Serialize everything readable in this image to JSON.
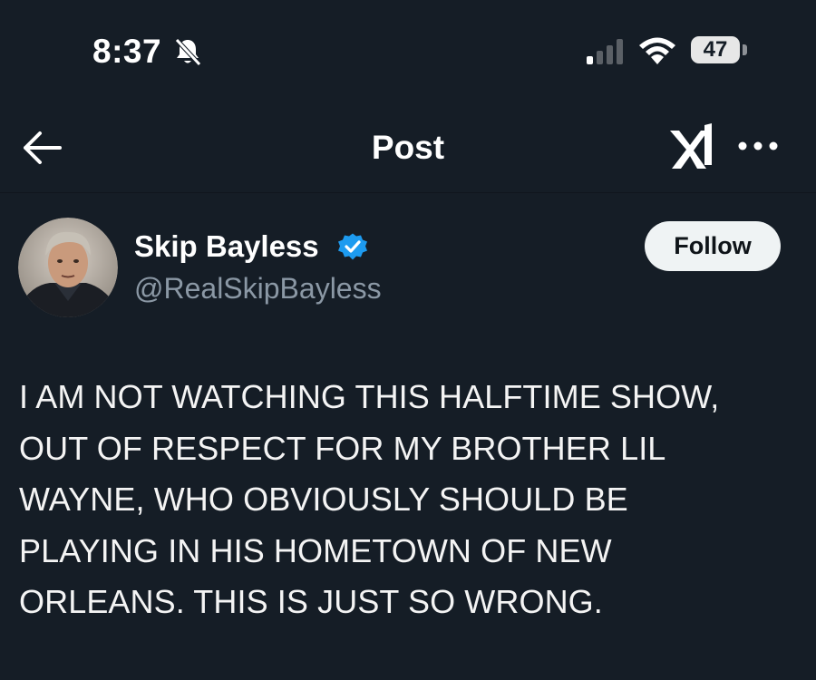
{
  "status_bar": {
    "time": "8:37",
    "battery": "47"
  },
  "header": {
    "title": "Post"
  },
  "post": {
    "author": {
      "name": "Skip Bayless",
      "handle": "@RealSkipBayless",
      "verified": true
    },
    "follow_label": "Follow",
    "text_lines": [
      "I AM NOT WATCHING THIS HALFTIME SHOW,",
      "OUT OF RESPECT FOR MY BROTHER LIL",
      "WAYNE, WHO OBVIOUSLY SHOULD BE",
      "PLAYING IN HIS HOMETOWN OF NEW",
      "ORLEANS. THIS IS JUST SO WRONG."
    ]
  },
  "icons": {
    "bell": "bell-muted-icon",
    "signal": "cellular-signal-icon",
    "wifi": "wifi-icon",
    "back": "arrow-left-icon",
    "grok": "grok-icon",
    "more": "more-horizontal-icon",
    "verified": "verified-badge-icon"
  },
  "colors": {
    "background": "#151d26",
    "text": "#ffffff",
    "secondary_text": "#8b98a5",
    "verified_blue": "#1d9bf0",
    "follow_button_bg": "#eff3f4"
  }
}
